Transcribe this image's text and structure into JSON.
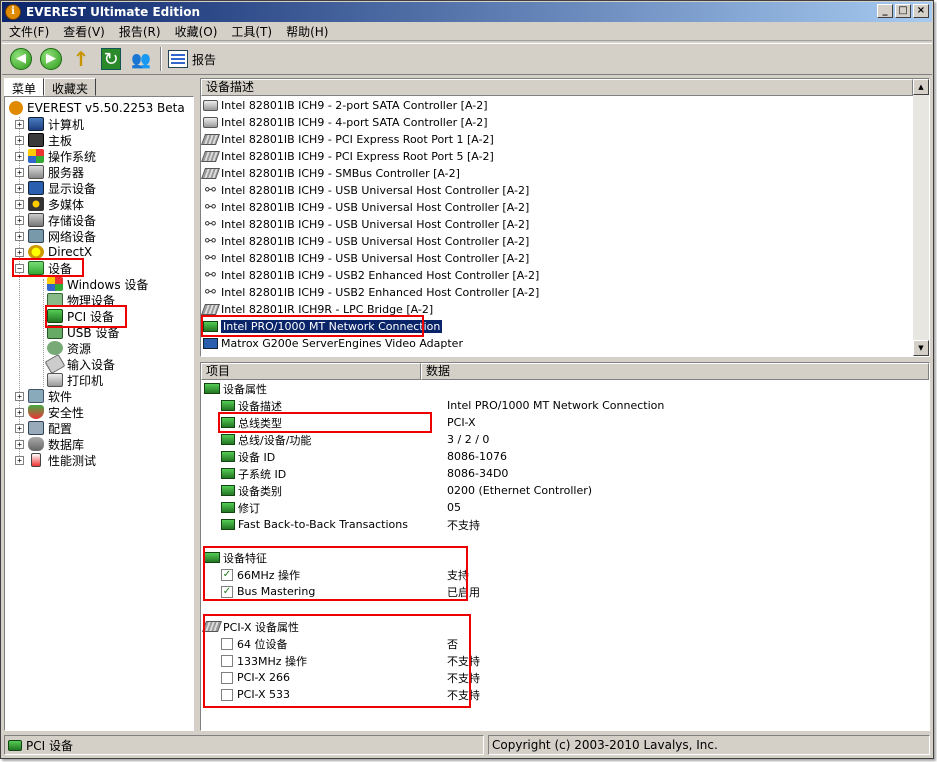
{
  "window": {
    "title": "EVEREST Ultimate Edition",
    "min_label": "_",
    "max_label": "□",
    "close_label": "×"
  },
  "menu": [
    "文件(F)",
    "查看(V)",
    "报告(R)",
    "收藏(O)",
    "工具(T)",
    "帮助(H)"
  ],
  "toolbar": {
    "back": "◀",
    "forward": "▶",
    "up": "↑",
    "refresh": "↻",
    "users": "👥",
    "report_label": "报告"
  },
  "tabs": [
    "菜单",
    "收藏夹"
  ],
  "tree": {
    "root": "EVEREST v5.50.2253 Beta",
    "items": [
      "计算机",
      "主板",
      "操作系统",
      "服务器",
      "显示设备",
      "多媒体",
      "存储设备",
      "网络设备",
      "DirectX",
      "设备"
    ],
    "device_children": [
      "Windows 设备",
      "物理设备",
      "PCI 设备",
      "USB 设备",
      "资源",
      "输入设备",
      "打印机"
    ],
    "after": [
      "软件",
      "安全性",
      "配置",
      "数据库",
      "性能测试"
    ]
  },
  "device_list": {
    "header": "设备描述",
    "rows": [
      "Intel 82801IB ICH9 - 2-port SATA Controller [A-2]",
      "Intel 82801IB ICH9 - 4-port SATA Controller [A-2]",
      "Intel 82801IB ICH9 - PCI Express Root Port 1 [A-2]",
      "Intel 82801IB ICH9 - PCI Express Root Port 5 [A-2]",
      "Intel 82801IB ICH9 - SMBus Controller [A-2]",
      "Intel 82801IB ICH9 - USB Universal Host Controller [A-2]",
      "Intel 82801IB ICH9 - USB Universal Host Controller [A-2]",
      "Intel 82801IB ICH9 - USB Universal Host Controller [A-2]",
      "Intel 82801IB ICH9 - USB Universal Host Controller [A-2]",
      "Intel 82801IB ICH9 - USB Universal Host Controller [A-2]",
      "Intel 82801IB ICH9 - USB2 Enhanced Host Controller [A-2]",
      "Intel 82801IB ICH9 - USB2 Enhanced Host Controller [A-2]",
      "Intel 82801IR ICH9R - LPC Bridge [A-2]",
      "Intel PRO/1000 MT Network Connection",
      "Matrox G200e ServerEngines Video Adapter"
    ],
    "selected": "Intel PRO/1000 MT Network Connection"
  },
  "properties": {
    "col_item": "项目",
    "col_data": "数据",
    "group1": {
      "title": "设备属性",
      "rows": [
        {
          "name": "设备描述",
          "value": "Intel PRO/1000 MT Network Connection"
        },
        {
          "name": "总线类型",
          "value": "PCI-X"
        },
        {
          "name": "总线/设备/功能",
          "value": "3 / 2 / 0"
        },
        {
          "name": "设备 ID",
          "value": "8086-1076"
        },
        {
          "name": "子系统 ID",
          "value": "8086-34D0"
        },
        {
          "name": "设备类别",
          "value": "0200 (Ethernet Controller)"
        },
        {
          "name": "修订",
          "value": "05"
        },
        {
          "name": "Fast Back-to-Back Transactions",
          "value": "不支持"
        }
      ]
    },
    "group2": {
      "title": "设备特征",
      "rows": [
        {
          "name": "66MHz 操作",
          "value": "支持",
          "checked": true
        },
        {
          "name": "Bus Mastering",
          "value": "已启用",
          "checked": true
        }
      ]
    },
    "group3": {
      "title": "PCI-X 设备属性",
      "rows": [
        {
          "name": "64 位设备",
          "value": "否",
          "checked": false
        },
        {
          "name": "133MHz 操作",
          "value": "不支持",
          "checked": false
        },
        {
          "name": "PCI-X 266",
          "value": "不支持",
          "checked": false
        },
        {
          "name": "PCI-X 533",
          "value": "不支持",
          "checked": false
        }
      ]
    }
  },
  "status": {
    "left": "PCI 设备",
    "right": "Copyright (c) 2003-2010 Lavalys, Inc."
  },
  "colors": {
    "title_start": "#0a246a",
    "title_end": "#a6caf0",
    "highlight": "#e00000",
    "selection": "#0a246a"
  }
}
